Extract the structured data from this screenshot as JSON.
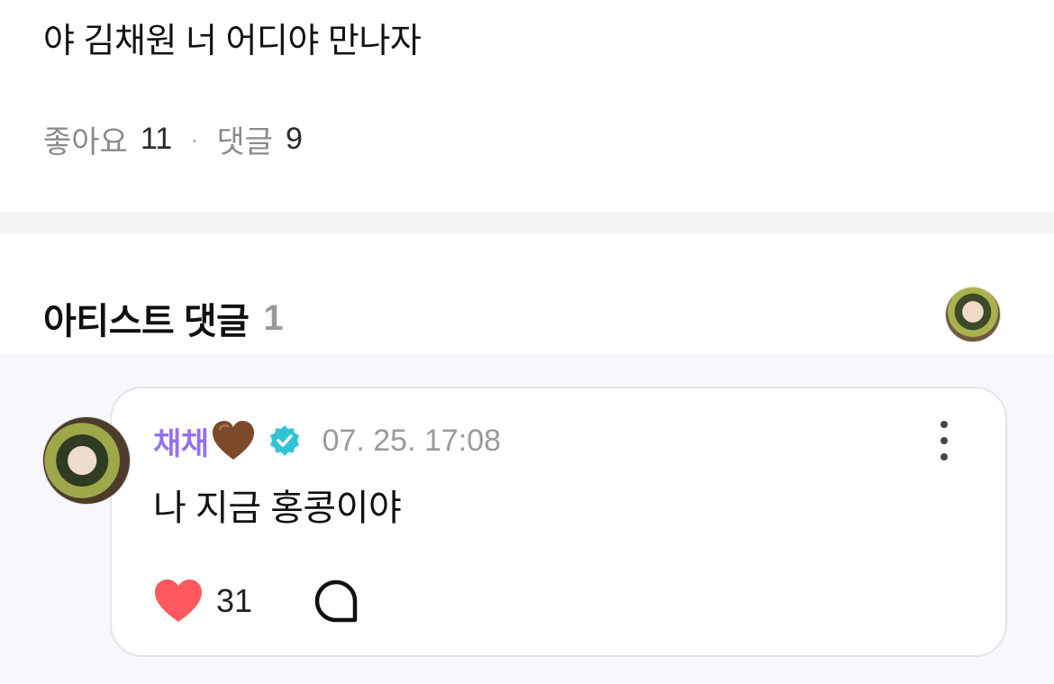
{
  "post": {
    "text": "야 김채원 너 어디야 만나자",
    "likes_label": "좋아요",
    "likes_count": "11",
    "separator": "·",
    "comments_label": "댓글",
    "comments_count": "9"
  },
  "artist_comments": {
    "title": "아티스트 댓글",
    "count": "1",
    "comment": {
      "author": "채채",
      "author_emoji": "brown-heart-icon",
      "verified": true,
      "timestamp": "07. 25. 17:08",
      "text": "나 지금 홍콩이야",
      "like_count": "31"
    }
  },
  "colors": {
    "author": "#9472f0",
    "verified_badge": "#2ec4d6",
    "like_heart": "#ff5a5f",
    "brown_heart": "#7a4a2a",
    "artist_area_bg": "#f8f8fc"
  }
}
